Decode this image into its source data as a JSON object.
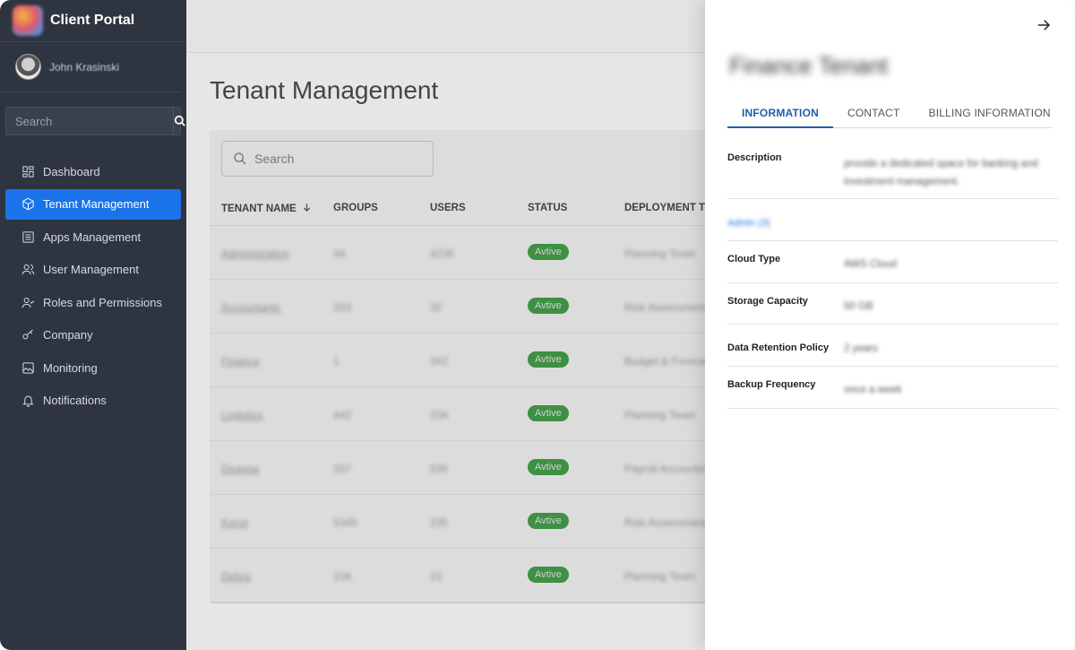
{
  "app": {
    "title": "Client Portal",
    "user_name": "John Krasinski",
    "search_placeholder": "Search"
  },
  "sidebar": {
    "items": [
      {
        "label": "Dashboard",
        "icon": "dashboard-icon"
      },
      {
        "label": "Tenant Management",
        "icon": "cube-icon",
        "active": true
      },
      {
        "label": "Apps Management",
        "icon": "list-icon"
      },
      {
        "label": "User Management",
        "icon": "users-icon"
      },
      {
        "label": "Roles and Permissions",
        "icon": "user-check-icon"
      },
      {
        "label": "Company",
        "icon": "key-icon"
      },
      {
        "label": "Monitoring",
        "icon": "image-icon"
      },
      {
        "label": "Notifications",
        "icon": "bell-icon"
      }
    ]
  },
  "main": {
    "page_title": "Tenant Management",
    "search_placeholder": "Search",
    "columns": [
      "TENANT NAME",
      "GROUPS",
      "USERS",
      "STATUS",
      "DEPLOYMENT TY"
    ],
    "rows": [
      {
        "name": "Administration",
        "groups": "34",
        "users": "4235",
        "status": "Avtive",
        "deployment": "Planning Team"
      },
      {
        "name": "Accountants",
        "groups": "333",
        "users": "32",
        "status": "Avtive",
        "deployment": "Risk Assessment"
      },
      {
        "name": "Finance",
        "groups": "1",
        "users": "342",
        "status": "Avtive",
        "deployment": "Budget & Forecast"
      },
      {
        "name": "Logistics",
        "groups": "442",
        "users": "234",
        "status": "Avtive",
        "deployment": "Planning Team"
      },
      {
        "name": "Deanna",
        "groups": "337",
        "users": "535",
        "status": "Avtive",
        "deployment": "Payroll Accounting"
      },
      {
        "name": "Kenzi",
        "groups": "5345",
        "users": "235",
        "status": "Avtive",
        "deployment": "Risk Assessment"
      },
      {
        "name": "Debra",
        "groups": "234",
        "users": "23",
        "status": "Avtive",
        "deployment": "Planning Team"
      }
    ]
  },
  "drawer": {
    "title": "Finance Tenant",
    "tabs": [
      "INFORMATION",
      "CONTACT",
      "BILLING INFORMATION"
    ],
    "active_tab": "INFORMATION",
    "description_label": "Description",
    "description_value": "provide a dedicated space for banking and investment management.",
    "admin_link": "Admin (3)",
    "fields": [
      {
        "label": "Cloud Type",
        "value": "AWS Cloud"
      },
      {
        "label": "Storage Capacity",
        "value": "50 GB"
      },
      {
        "label": "Data Retention Policy",
        "value": "2 years"
      },
      {
        "label": "Backup Frequency",
        "value": "once a week"
      }
    ]
  },
  "colors": {
    "sidebar_bg": "#2e3440",
    "accent": "#1a73e8",
    "status_active": "#4caf50",
    "tab_active": "#1f5fa8"
  }
}
